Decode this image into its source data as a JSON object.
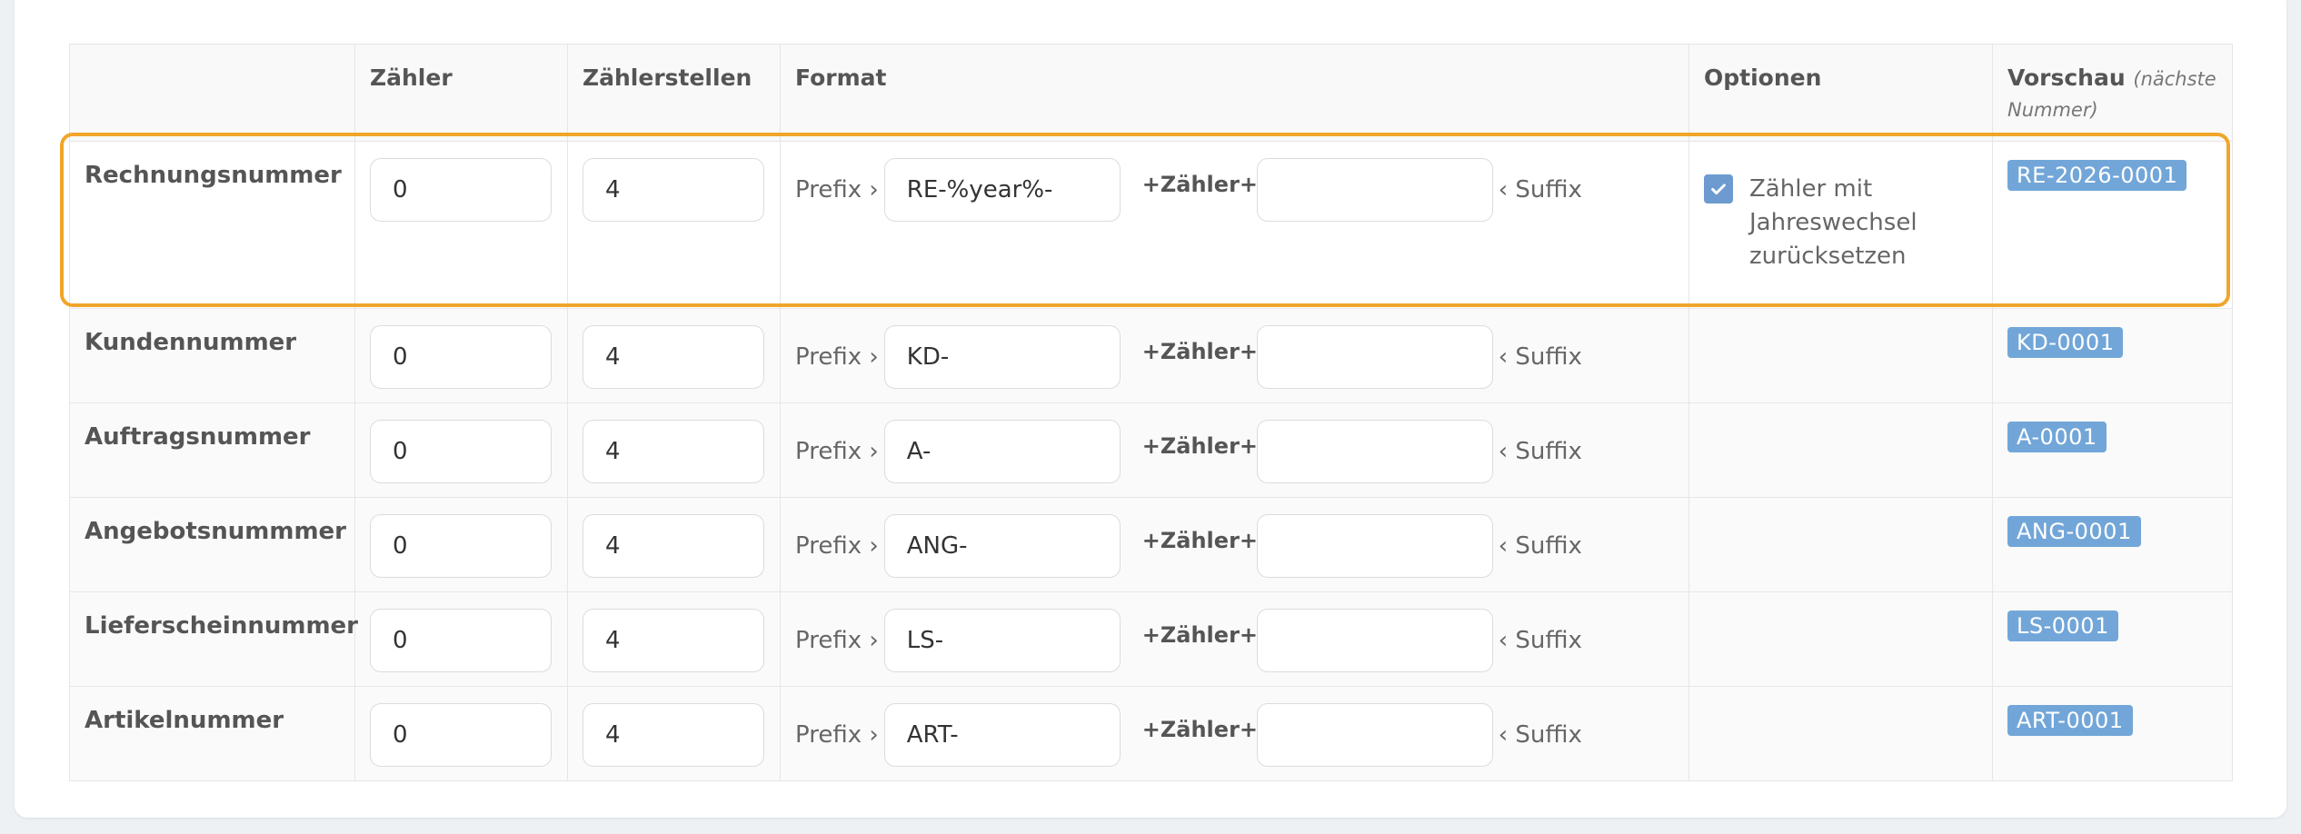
{
  "headers": {
    "name": "",
    "counter": "Zähler",
    "digits": "Zählerstellen",
    "format": "Format",
    "options": "Optionen",
    "preview": "Vorschau",
    "preview_sub": "(nächste Nummer)"
  },
  "labels": {
    "prefix": "Prefix ›",
    "counter_token": "+Zähler+",
    "suffix": "‹ Suffix"
  },
  "rows": [
    {
      "name": "Rechnungsnummer",
      "counter": "0",
      "digits": "4",
      "prefix": "RE-%year%-",
      "suffix": "",
      "option_label": "Zähler mit Jahreswechsel zurücksetzen",
      "option_checked": true,
      "preview": "RE-2026-0001"
    },
    {
      "name": "Kundennummer",
      "counter": "0",
      "digits": "4",
      "prefix": "KD-",
      "suffix": "",
      "preview": "KD-0001"
    },
    {
      "name": "Auftragsnummer",
      "counter": "0",
      "digits": "4",
      "prefix": "A-",
      "suffix": "",
      "preview": "A-0001"
    },
    {
      "name": "Angebotsnummmer",
      "counter": "0",
      "digits": "4",
      "prefix": "ANG-",
      "suffix": "",
      "preview": "ANG-0001"
    },
    {
      "name": "Lieferscheinnummer",
      "counter": "0",
      "digits": "4",
      "prefix": "LS-",
      "suffix": "",
      "preview": "LS-0001"
    },
    {
      "name": "Artikelnummer",
      "counter": "0",
      "digits": "4",
      "prefix": "ART-",
      "suffix": "",
      "preview": "ART-0001"
    }
  ],
  "colors": {
    "highlight": "#f0a52a",
    "badge": "#72a6d8",
    "checkbox": "#6d9bd0"
  }
}
